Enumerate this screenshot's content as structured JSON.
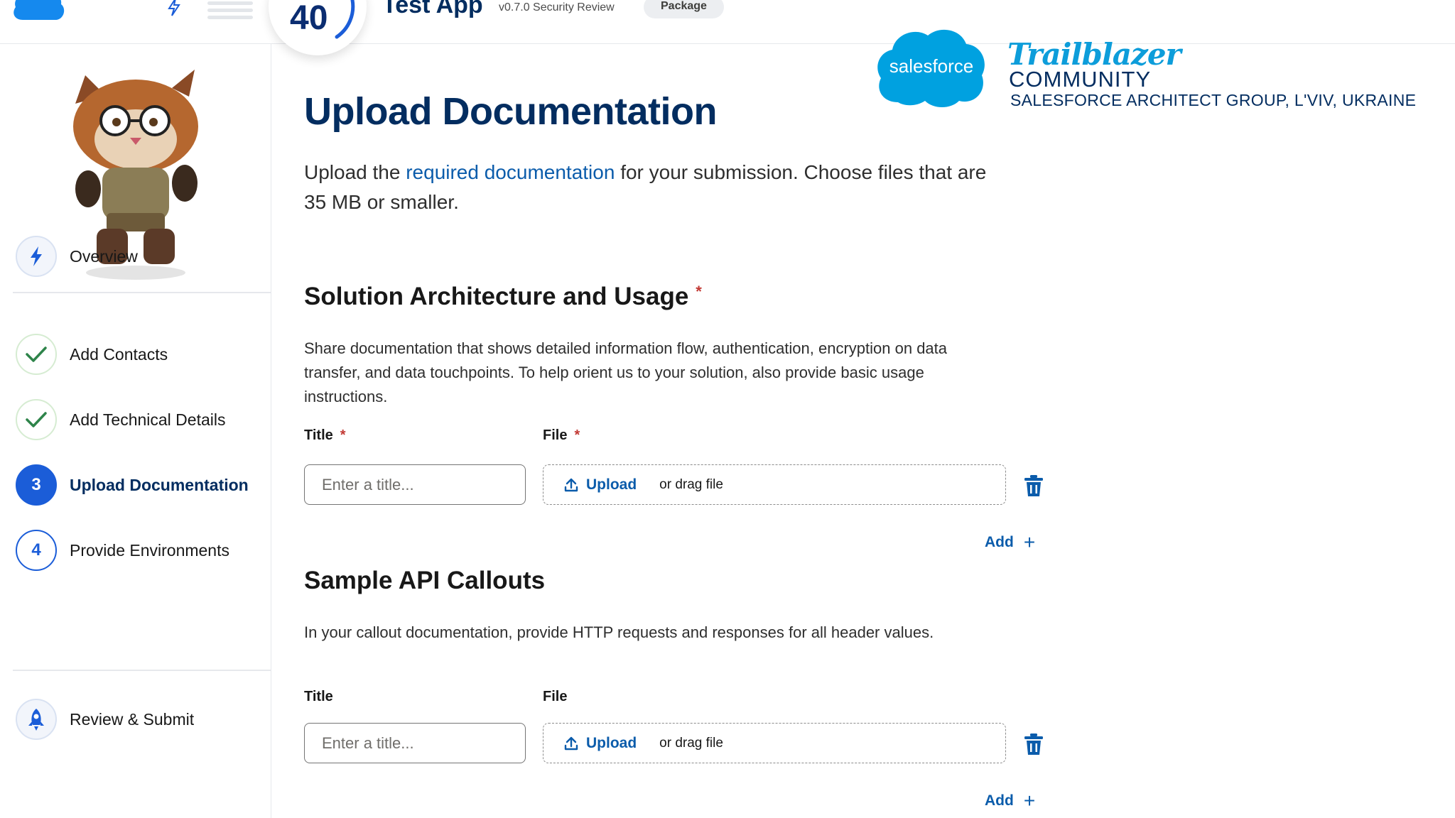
{
  "header": {
    "badge_number": "40",
    "app_title": "Test App",
    "version": "v0.7.0 Security Review",
    "package_label": "Package"
  },
  "brand": {
    "salesforce": "salesforce",
    "trailblazer": "Trailblazer",
    "community": "COMMUNITY",
    "group": "SALESFORCE ARCHITECT GROUP, L'VIV, UKRAINE",
    "colors": {
      "sf_blue": "#00a1e0",
      "navy": "#032d60"
    }
  },
  "sidebar": {
    "steps": [
      {
        "label": "Overview",
        "marker": "bolt-icon",
        "state": "info"
      },
      {
        "label": "Add Contacts",
        "marker": "check-icon",
        "state": "complete"
      },
      {
        "label": "Add Technical Details",
        "marker": "check-icon",
        "state": "complete"
      },
      {
        "label": "Upload Documentation",
        "marker": "3",
        "state": "current"
      },
      {
        "label": "Provide Environments",
        "marker": "4",
        "state": "todo"
      },
      {
        "label": "Review & Submit",
        "marker": "rocket-icon",
        "state": "info"
      }
    ]
  },
  "main": {
    "title": "Upload Documentation",
    "intro_before": "Upload the ",
    "intro_link": "required documentation",
    "intro_after": " for your submission. Choose files that are 35 MB or smaller.",
    "sections": [
      {
        "title": "Solution Architecture and Usage",
        "required": "*",
        "description": "Share documentation that shows detailed information flow, authentication, encryption on data transfer, and data touchpoints. To help orient us to your solution, also provide basic usage instructions.",
        "title_label": "Title",
        "file_label": "File",
        "title_placeholder": "Enter a title...",
        "upload_label": "Upload",
        "drag_text": "or drag file",
        "add_label": "Add"
      },
      {
        "title": "Sample API Callouts",
        "description": "In your callout documentation, provide HTTP requests and responses for all header values.",
        "title_label": "Title",
        "file_label": "File",
        "title_placeholder": "Enter a title...",
        "upload_label": "Upload",
        "drag_text": "or drag file",
        "add_label": "Add"
      }
    ]
  }
}
